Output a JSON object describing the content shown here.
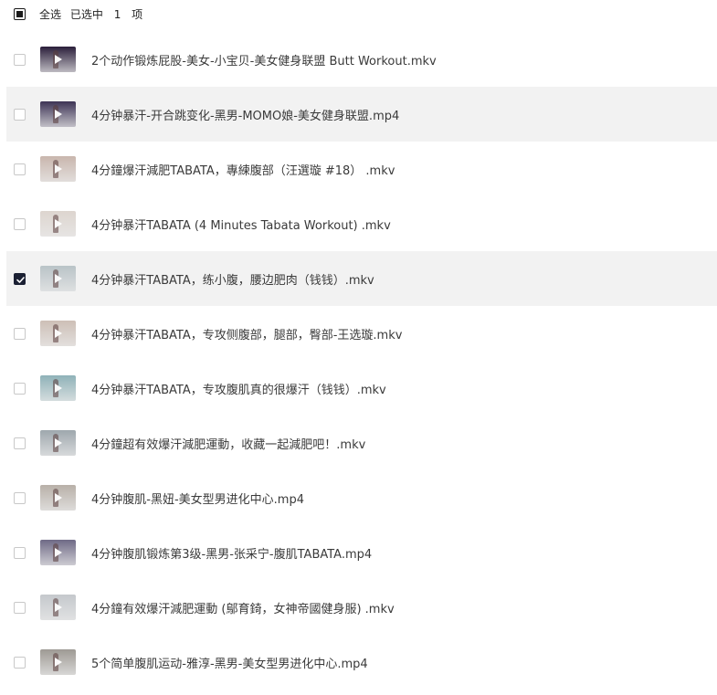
{
  "header": {
    "select_all_label": "全选",
    "selected_label": "已选中",
    "selected_count": "1",
    "unit_label": "项"
  },
  "files": [
    {
      "name": "2个动作锻炼屁股-美女-小宝贝-美女健身联盟 Butt Workout.mkv",
      "checked": false,
      "highlight": false,
      "thumb_color": "#2a1e3a"
    },
    {
      "name": "4分钟暴汗-开合跳变化-黑男-MOMO娘-美女健身联盟.mp4",
      "checked": false,
      "highlight": true,
      "thumb_color": "#3d3355"
    },
    {
      "name": "4分鐘爆汗減肥TABATA，專練腹部（汪選璇 #18） .mkv",
      "checked": false,
      "highlight": false,
      "thumb_color": "#c9b6ad"
    },
    {
      "name": "4分钟暴汗TABATA (4 Minutes Tabata Workout) .mkv",
      "checked": false,
      "highlight": false,
      "thumb_color": "#ddd5cf"
    },
    {
      "name": "4分钟暴汗TABATA，练小腹，腰边肥肉（钱钱）.mkv",
      "checked": true,
      "highlight": true,
      "thumb_color": "#b9c3c7"
    },
    {
      "name": "4分钟暴汗TABATA，专攻侧腹部，腿部，臀部-王选璇.mkv",
      "checked": false,
      "highlight": false,
      "thumb_color": "#cdbfb6"
    },
    {
      "name": "4分钟暴汗TABATA，专攻腹肌真的很爆汗（钱钱）.mkv",
      "checked": false,
      "highlight": false,
      "thumb_color": "#8fb2b8"
    },
    {
      "name": "4分鐘超有效爆汗減肥運動，收藏一起減肥吧！.mkv",
      "checked": false,
      "highlight": false,
      "thumb_color": "#9ea7ad"
    },
    {
      "name": "4分钟腹肌-黑妞-美女型男进化中心.mp4",
      "checked": false,
      "highlight": false,
      "thumb_color": "#b8b0a8"
    },
    {
      "name": "4分钟腹肌锻炼第3级-黑男-张采宁-腹肌TABATA.mp4",
      "checked": false,
      "highlight": false,
      "thumb_color": "#6f6a86"
    },
    {
      "name": "4分鐘有效爆汗減肥運動 (鄔育錡，女神帝國健身服) .mkv",
      "checked": false,
      "highlight": false,
      "thumb_color": "#c4c8cc"
    },
    {
      "name": "5个简单腹肌运动-雅淳-黑男-美女型男进化中心.mp4",
      "checked": false,
      "highlight": false,
      "thumb_color": "#9e9a94"
    }
  ]
}
